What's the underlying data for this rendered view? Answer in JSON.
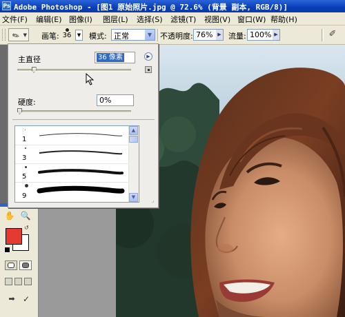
{
  "window": {
    "title": "Adobe Photoshop - [图1 原始照片.jpg @ 72.6% (背景 副本, RGB/8)]",
    "app_icon": "Ps"
  },
  "menu": [
    "文件(F)",
    "编辑(E)",
    "图像(I)",
    "图层(L)",
    "选择(S)",
    "滤镜(T)",
    "视图(V)",
    "窗口(W)",
    "帮助(H)"
  ],
  "options": {
    "brush_label": "画笔:",
    "brush_size": "36",
    "mode_label": "模式:",
    "mode_value": "正常",
    "opacity_label": "不透明度:",
    "opacity_value": "76%",
    "flow_label": "流量:",
    "flow_value": "100%",
    "airbrush_icon": "airbrush-icon"
  },
  "brush_popup": {
    "master_diameter_label": "主直径",
    "master_diameter_value": "36 像素",
    "master_diameter_fraction": 0.13,
    "hardness_label": "硬度:",
    "hardness_value": "0%",
    "hardness_fraction": 0.0,
    "presets": [
      {
        "size": "1"
      },
      {
        "size": "3"
      },
      {
        "size": "5"
      },
      {
        "size": "9"
      }
    ]
  },
  "colors": {
    "foreground": "#e43a32",
    "background": "#ffffff",
    "titlebar": "#0a3fb8",
    "chrome": "#ece9d8"
  }
}
